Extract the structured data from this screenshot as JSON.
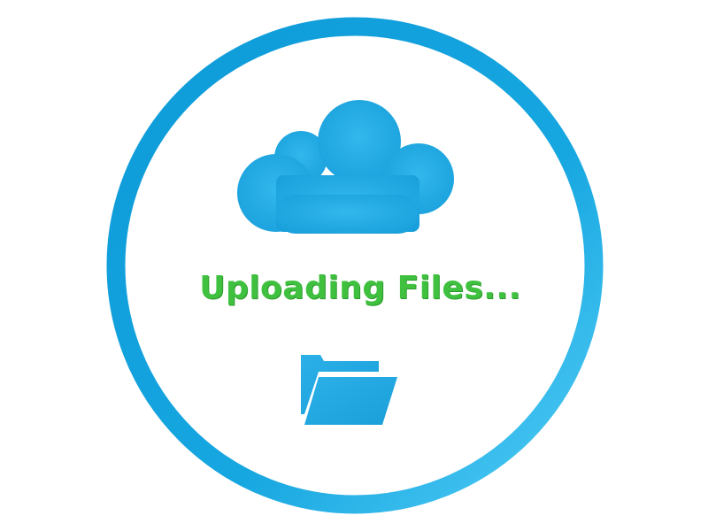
{
  "status": {
    "message": "Uploading Files..."
  },
  "icons": {
    "cloud": "cloud-icon",
    "folder": "open-folder-icon"
  },
  "colors": {
    "ring": "#11a1dc",
    "ring_highlight": "#4ecaf4",
    "icon": "#1ea8e0",
    "text": "#3fc13f",
    "background": "#ffffff"
  }
}
